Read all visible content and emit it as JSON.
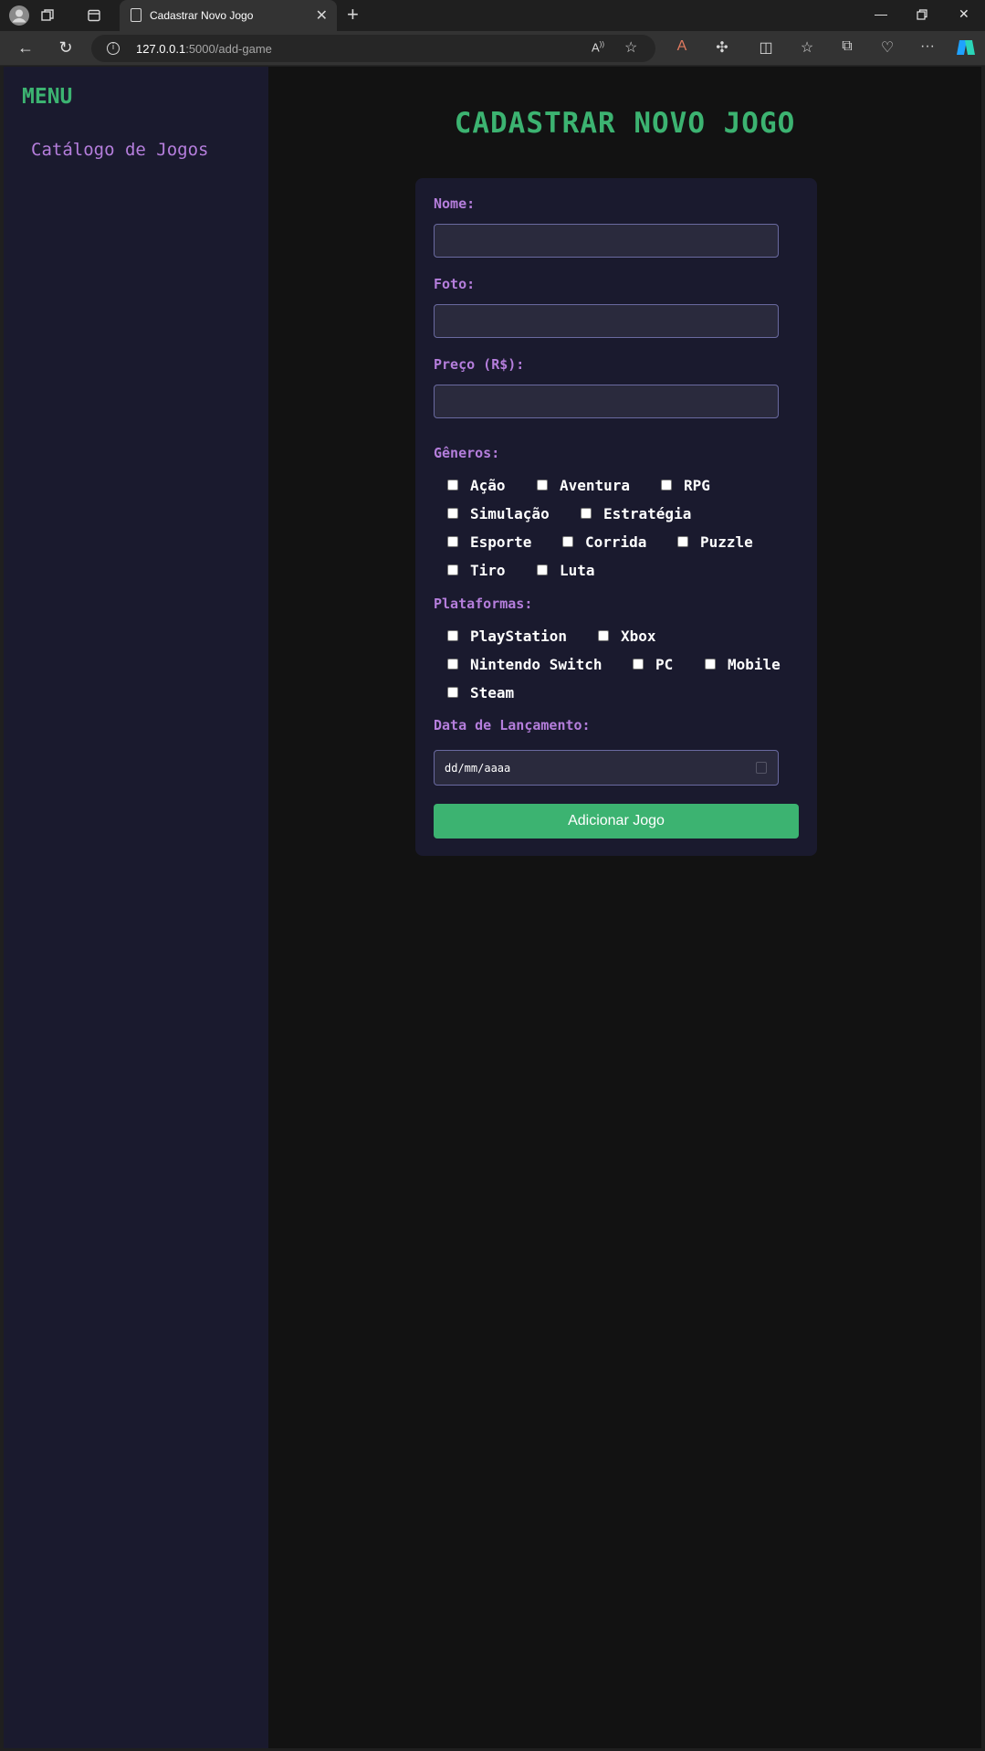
{
  "browser": {
    "tab_title": "Cadastrar Novo Jogo",
    "url_host": "127.0.0.1",
    "url_path": ":5000/add-game"
  },
  "sidebar": {
    "title": "MENU",
    "items": [
      {
        "label": "Catálogo de Jogos"
      }
    ]
  },
  "page": {
    "title": "CADASTRAR NOVO JOGO"
  },
  "form": {
    "name_label": "Nome:",
    "name_value": "",
    "photo_label": "Foto:",
    "photo_value": "",
    "price_label": "Preço (R$):",
    "price_value": "",
    "genres_label": "Gêneros:",
    "genres": [
      "Ação",
      "Aventura",
      "RPG",
      "Simulação",
      "Estratégia",
      "Esporte",
      "Corrida",
      "Puzzle",
      "Tiro",
      "Luta"
    ],
    "platforms_label": "Plataformas:",
    "platforms": [
      "PlayStation",
      "Xbox",
      "Nintendo Switch",
      "PC",
      "Mobile",
      "Steam"
    ],
    "release_label": "Data de Lançamento:",
    "release_placeholder": "dd/mm/aaaa",
    "submit_label": "Adicionar Jogo"
  },
  "colors": {
    "accent_green": "#3cb371",
    "label_purple": "#b57edc",
    "sidebar_bg": "#1a1a2e",
    "page_bg": "#121212"
  }
}
